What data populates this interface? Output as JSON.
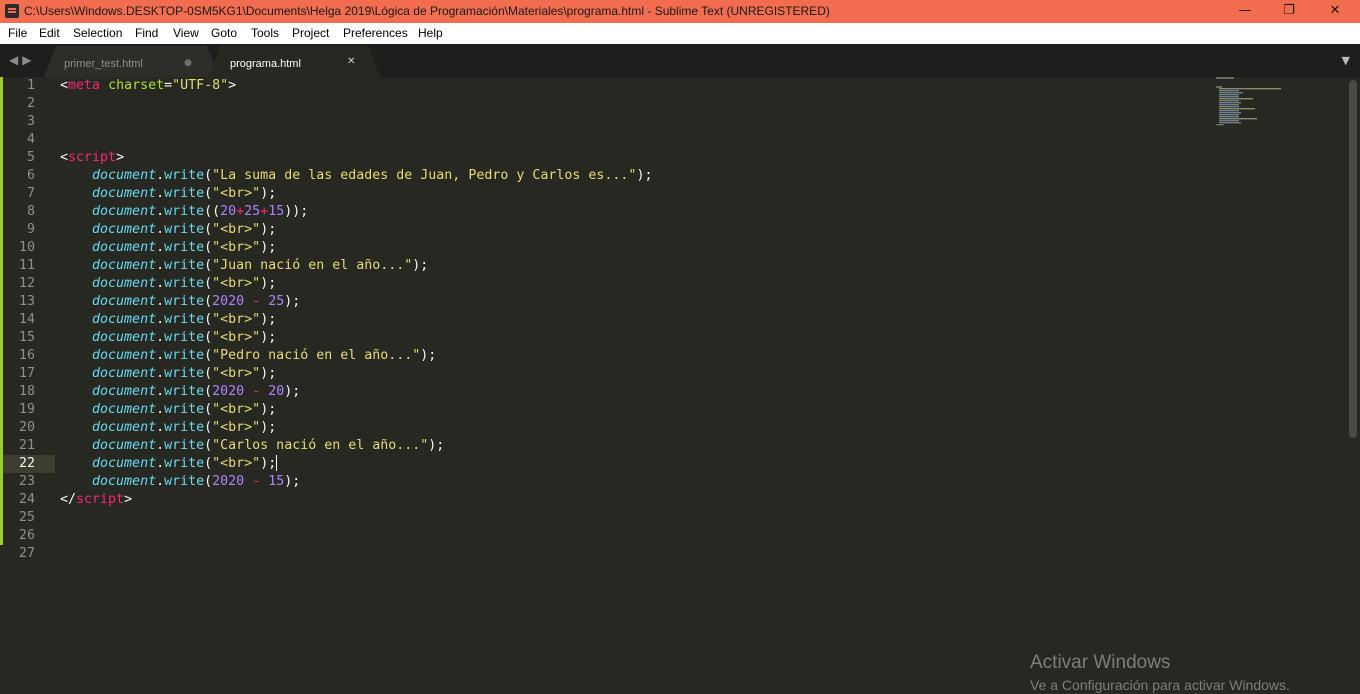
{
  "window": {
    "title": "C:\\Users\\Windows.DESKTOP-0SM5KG1\\Documents\\Helga 2019\\Lógica de Programación\\Materiales\\programa.html - Sublime Text (UNREGISTERED)",
    "minimize": "—",
    "maximize": "❐",
    "close": "✕"
  },
  "menu": [
    "File",
    "Edit",
    "Selection",
    "Find",
    "View",
    "Goto",
    "Tools",
    "Project",
    "Preferences",
    "Help"
  ],
  "tabs": [
    {
      "label": "primer_test.html",
      "indicator": "●",
      "active": false
    },
    {
      "label": "programa.html",
      "indicator": "✕",
      "active": true
    }
  ],
  "nav": {
    "back": "◀",
    "forward": "▶",
    "dropdown": "▼"
  },
  "editor": {
    "current_line": 22,
    "lines": [
      [
        {
          "t": "<",
          "c": "#f8f8f2"
        },
        {
          "t": "meta",
          "c": "#f92672"
        },
        {
          "t": " ",
          "c": "#f8f8f2"
        },
        {
          "t": "charset",
          "c": "#a6e22e"
        },
        {
          "t": "=",
          "c": "#f8f8f2"
        },
        {
          "t": "\"UTF-8\"",
          "c": "#e6db74"
        },
        {
          "t": ">",
          "c": "#f8f8f2"
        }
      ],
      [],
      [],
      [],
      [
        {
          "t": "<",
          "c": "#f8f8f2"
        },
        {
          "t": "script",
          "c": "#f92672"
        },
        {
          "t": ">",
          "c": "#f8f8f2"
        }
      ],
      [
        {
          "t": "    "
        },
        {
          "t": "document",
          "c": "#66d9ef",
          "i": true
        },
        {
          "t": "."
        },
        {
          "t": "write",
          "c": "#66d9ef"
        },
        {
          "t": "("
        },
        {
          "t": "\"La suma de las edades de Juan, Pedro y Carlos es...\"",
          "c": "#e6db74"
        },
        {
          "t": ");"
        }
      ],
      [
        {
          "t": "    "
        },
        {
          "t": "document",
          "c": "#66d9ef",
          "i": true
        },
        {
          "t": "."
        },
        {
          "t": "write",
          "c": "#66d9ef"
        },
        {
          "t": "("
        },
        {
          "t": "\"<br>\"",
          "c": "#e6db74"
        },
        {
          "t": ");"
        }
      ],
      [
        {
          "t": "    "
        },
        {
          "t": "document",
          "c": "#66d9ef",
          "i": true
        },
        {
          "t": "."
        },
        {
          "t": "write",
          "c": "#66d9ef"
        },
        {
          "t": "(("
        },
        {
          "t": "20",
          "c": "#ae81ff"
        },
        {
          "t": "+",
          "c": "#f92672"
        },
        {
          "t": "25",
          "c": "#ae81ff"
        },
        {
          "t": "+",
          "c": "#f92672"
        },
        {
          "t": "15",
          "c": "#ae81ff"
        },
        {
          "t": "));"
        }
      ],
      [
        {
          "t": "    "
        },
        {
          "t": "document",
          "c": "#66d9ef",
          "i": true
        },
        {
          "t": "."
        },
        {
          "t": "write",
          "c": "#66d9ef"
        },
        {
          "t": "("
        },
        {
          "t": "\"<br>\"",
          "c": "#e6db74"
        },
        {
          "t": ");"
        }
      ],
      [
        {
          "t": "    "
        },
        {
          "t": "document",
          "c": "#66d9ef",
          "i": true
        },
        {
          "t": "."
        },
        {
          "t": "write",
          "c": "#66d9ef"
        },
        {
          "t": "("
        },
        {
          "t": "\"<br>\"",
          "c": "#e6db74"
        },
        {
          "t": ");"
        }
      ],
      [
        {
          "t": "    "
        },
        {
          "t": "document",
          "c": "#66d9ef",
          "i": true
        },
        {
          "t": "."
        },
        {
          "t": "write",
          "c": "#66d9ef"
        },
        {
          "t": "("
        },
        {
          "t": "\"Juan nació en el año...\"",
          "c": "#e6db74"
        },
        {
          "t": ");"
        }
      ],
      [
        {
          "t": "    "
        },
        {
          "t": "document",
          "c": "#66d9ef",
          "i": true
        },
        {
          "t": "."
        },
        {
          "t": "write",
          "c": "#66d9ef"
        },
        {
          "t": "("
        },
        {
          "t": "\"<br>\"",
          "c": "#e6db74"
        },
        {
          "t": ");"
        }
      ],
      [
        {
          "t": "    "
        },
        {
          "t": "document",
          "c": "#66d9ef",
          "i": true
        },
        {
          "t": "."
        },
        {
          "t": "write",
          "c": "#66d9ef"
        },
        {
          "t": "("
        },
        {
          "t": "2020",
          "c": "#ae81ff"
        },
        {
          "t": " "
        },
        {
          "t": "-",
          "c": "#f92672"
        },
        {
          "t": " "
        },
        {
          "t": "25",
          "c": "#ae81ff"
        },
        {
          "t": ");"
        }
      ],
      [
        {
          "t": "    "
        },
        {
          "t": "document",
          "c": "#66d9ef",
          "i": true
        },
        {
          "t": "."
        },
        {
          "t": "write",
          "c": "#66d9ef"
        },
        {
          "t": "("
        },
        {
          "t": "\"<br>\"",
          "c": "#e6db74"
        },
        {
          "t": ");"
        }
      ],
      [
        {
          "t": "    "
        },
        {
          "t": "document",
          "c": "#66d9ef",
          "i": true
        },
        {
          "t": "."
        },
        {
          "t": "write",
          "c": "#66d9ef"
        },
        {
          "t": "("
        },
        {
          "t": "\"<br>\"",
          "c": "#e6db74"
        },
        {
          "t": ");"
        }
      ],
      [
        {
          "t": "    "
        },
        {
          "t": "document",
          "c": "#66d9ef",
          "i": true
        },
        {
          "t": "."
        },
        {
          "t": "write",
          "c": "#66d9ef"
        },
        {
          "t": "("
        },
        {
          "t": "\"Pedro nació en el año...\"",
          "c": "#e6db74"
        },
        {
          "t": ");"
        }
      ],
      [
        {
          "t": "    "
        },
        {
          "t": "document",
          "c": "#66d9ef",
          "i": true
        },
        {
          "t": "."
        },
        {
          "t": "write",
          "c": "#66d9ef"
        },
        {
          "t": "("
        },
        {
          "t": "\"<br>\"",
          "c": "#e6db74"
        },
        {
          "t": ");"
        }
      ],
      [
        {
          "t": "    "
        },
        {
          "t": "document",
          "c": "#66d9ef",
          "i": true
        },
        {
          "t": "."
        },
        {
          "t": "write",
          "c": "#66d9ef"
        },
        {
          "t": "("
        },
        {
          "t": "2020",
          "c": "#ae81ff"
        },
        {
          "t": " "
        },
        {
          "t": "-",
          "c": "#f92672"
        },
        {
          "t": " "
        },
        {
          "t": "20",
          "c": "#ae81ff"
        },
        {
          "t": ");"
        }
      ],
      [
        {
          "t": "    "
        },
        {
          "t": "document",
          "c": "#66d9ef",
          "i": true
        },
        {
          "t": "."
        },
        {
          "t": "write",
          "c": "#66d9ef"
        },
        {
          "t": "("
        },
        {
          "t": "\"<br>\"",
          "c": "#e6db74"
        },
        {
          "t": ");"
        }
      ],
      [
        {
          "t": "    "
        },
        {
          "t": "document",
          "c": "#66d9ef",
          "i": true
        },
        {
          "t": "."
        },
        {
          "t": "write",
          "c": "#66d9ef"
        },
        {
          "t": "("
        },
        {
          "t": "\"<br>\"",
          "c": "#e6db74"
        },
        {
          "t": ");"
        }
      ],
      [
        {
          "t": "    "
        },
        {
          "t": "document",
          "c": "#66d9ef",
          "i": true
        },
        {
          "t": "."
        },
        {
          "t": "write",
          "c": "#66d9ef"
        },
        {
          "t": "("
        },
        {
          "t": "\"Carlos nació en el año...\"",
          "c": "#e6db74"
        },
        {
          "t": ");"
        }
      ],
      [
        {
          "t": "    "
        },
        {
          "t": "document",
          "c": "#66d9ef",
          "i": true
        },
        {
          "t": "."
        },
        {
          "t": "write",
          "c": "#66d9ef"
        },
        {
          "t": "("
        },
        {
          "t": "\"<br>\"",
          "c": "#e6db74"
        },
        {
          "t": ");"
        },
        {
          "cursor": true
        }
      ],
      [
        {
          "t": "    "
        },
        {
          "t": "document",
          "c": "#66d9ef",
          "i": true
        },
        {
          "t": "."
        },
        {
          "t": "write",
          "c": "#66d9ef"
        },
        {
          "t": "("
        },
        {
          "t": "2020",
          "c": "#ae81ff"
        },
        {
          "t": " "
        },
        {
          "t": "-",
          "c": "#f92672"
        },
        {
          "t": " "
        },
        {
          "t": "15",
          "c": "#ae81ff"
        },
        {
          "t": ");"
        }
      ],
      [
        {
          "t": "</",
          "c": "#f8f8f2"
        },
        {
          "t": "script",
          "c": "#f92672"
        },
        {
          "t": ">",
          "c": "#f8f8f2"
        }
      ],
      [],
      [],
      []
    ]
  },
  "watermark": {
    "line1": "Activar Windows",
    "line2": "Ve a Configuración para activar Windows."
  },
  "colors": {
    "titlebar": "#f26d50",
    "editor_bg": "#272822",
    "tabbar_bg": "#1e1f1c",
    "modified_marker": "#9bcc2a"
  }
}
